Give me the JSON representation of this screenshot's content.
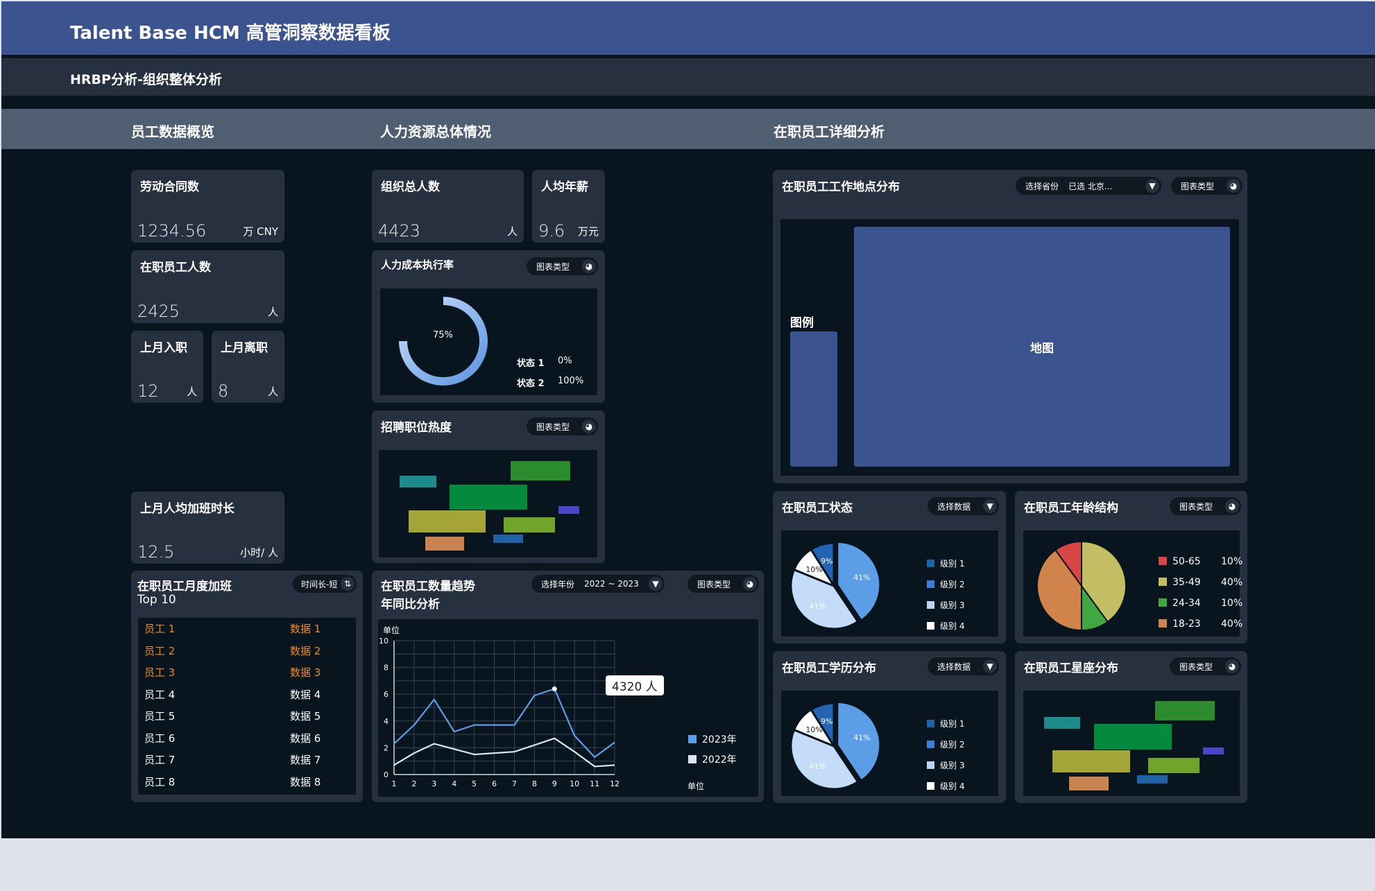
{
  "app": {
    "title": "Talent Base HCM 高管洞察数据看板",
    "subtitle": "HRBP分析-组织整体分析"
  },
  "sections": {
    "overview": "员工数据概览",
    "hr_general": "人力资源总体情况",
    "detail": "在职员工详细分析"
  },
  "kpi": {
    "contracts": {
      "label": "劳动合同数",
      "value": "1234.56",
      "unit": "万 CNY"
    },
    "active": {
      "label": "在职员工人数",
      "value": "2425",
      "unit": "人"
    },
    "hired": {
      "label": "上月入职",
      "value": "12",
      "unit": "人"
    },
    "left": {
      "label": "上月离职",
      "value": "8",
      "unit": "人"
    },
    "overtime": {
      "label": "上月人均加班时长",
      "value": "12.5",
      "unit": "小时/ 人"
    },
    "org_total": {
      "label": "组织总人数",
      "value": "4423",
      "unit": "人"
    },
    "salary": {
      "label": "人均年薪",
      "value": "9.6",
      "unit": "万元"
    }
  },
  "controls": {
    "chart_type": "图表类型",
    "select_data": "选择数据",
    "select_year": "选择年份",
    "year_range": "2022 ~ 2023",
    "select_province": "选择省份",
    "province_value": "已选 北京...",
    "sort_label": "时间长-短"
  },
  "cost": {
    "title": "人力成本执行率",
    "percent_label": "75%",
    "percent": 0.75,
    "states": [
      {
        "name": "状态 1",
        "value": "0%"
      },
      {
        "name": "状态 2",
        "value": "100%"
      }
    ]
  },
  "recruit": {
    "title": "招聘职位热度"
  },
  "overtime_top": {
    "title": "在职员工月度加班",
    "subtitle": "Top 10",
    "rows": [
      {
        "name": "员工 1",
        "value": "数据 1",
        "highlight": true
      },
      {
        "name": "员工 2",
        "value": "数据 2",
        "highlight": true
      },
      {
        "name": "员工 3",
        "value": "数据 3",
        "highlight": true
      },
      {
        "name": "员工 4",
        "value": "数据 4",
        "highlight": false
      },
      {
        "name": "员工 5",
        "value": "数据 5",
        "highlight": false
      },
      {
        "name": "员工 6",
        "value": "数据 6",
        "highlight": false
      },
      {
        "name": "员工 7",
        "value": "数据 7",
        "highlight": false
      },
      {
        "name": "员工 8",
        "value": "数据 8",
        "highlight": false
      }
    ]
  },
  "trend": {
    "title_line1": "在职员工数量趋势",
    "title_line2": "年同比分析",
    "ylabel": "单位",
    "xlabel": "单位",
    "tooltip": "4320 人"
  },
  "map": {
    "title": "在职员工工作地点分布",
    "legend_label": "图例",
    "map_label": "地图"
  },
  "status": {
    "title": "在职员工状态"
  },
  "age": {
    "title": "在职员工年龄结构"
  },
  "education": {
    "title": "在职员工学历分布"
  },
  "zodiac": {
    "title": "在职员工星座分布"
  },
  "level_legend": [
    "级别 1",
    "级别 2",
    "级别 3",
    "级别 4"
  ],
  "colors": {
    "accent": "#3b548f",
    "orange": "#f08a24",
    "line2023": "#5b9de6",
    "line2022": "#dbe6f5"
  },
  "chart_data": [
    {
      "type": "line",
      "title": "",
      "xlabel": "单位",
      "ylabel": "单位",
      "x": [
        1,
        2,
        3,
        4,
        5,
        6,
        7,
        8,
        9,
        10,
        11,
        12
      ],
      "ylim": [
        0,
        10
      ],
      "grid": true,
      "legend": "right",
      "series": [
        {
          "name": "2023年",
          "values": [
            2.3,
            3.7,
            5.6,
            3.2,
            3.7,
            3.7,
            3.7,
            5.9,
            6.4,
            2.9,
            1.3,
            2.4
          ]
        },
        {
          "name": "2022年",
          "values": [
            0.7,
            1.6,
            2.3,
            1.9,
            1.5,
            1.6,
            1.7,
            2.2,
            2.7,
            1.7,
            0.6,
            0.7
          ]
        }
      ]
    },
    {
      "type": "pie",
      "title": "",
      "labels": [
        "级别 1",
        "级别 2",
        "级别 3",
        "级别 4"
      ],
      "values": [
        9,
        41,
        41,
        10
      ],
      "legend": "right"
    },
    {
      "type": "pie",
      "title": "",
      "labels": [
        "50-65",
        "35-49",
        "24-34",
        "18-23"
      ],
      "values": [
        10,
        40,
        10,
        40
      ],
      "value_labels": [
        "10%",
        "40%",
        "10%",
        "40%"
      ],
      "legend": "right"
    },
    {
      "type": "pie",
      "title": "",
      "labels": [
        "级别 1",
        "级别 2",
        "级别 3",
        "级别 4"
      ],
      "values": [
        9,
        41,
        41,
        10
      ],
      "legend": "right"
    }
  ]
}
